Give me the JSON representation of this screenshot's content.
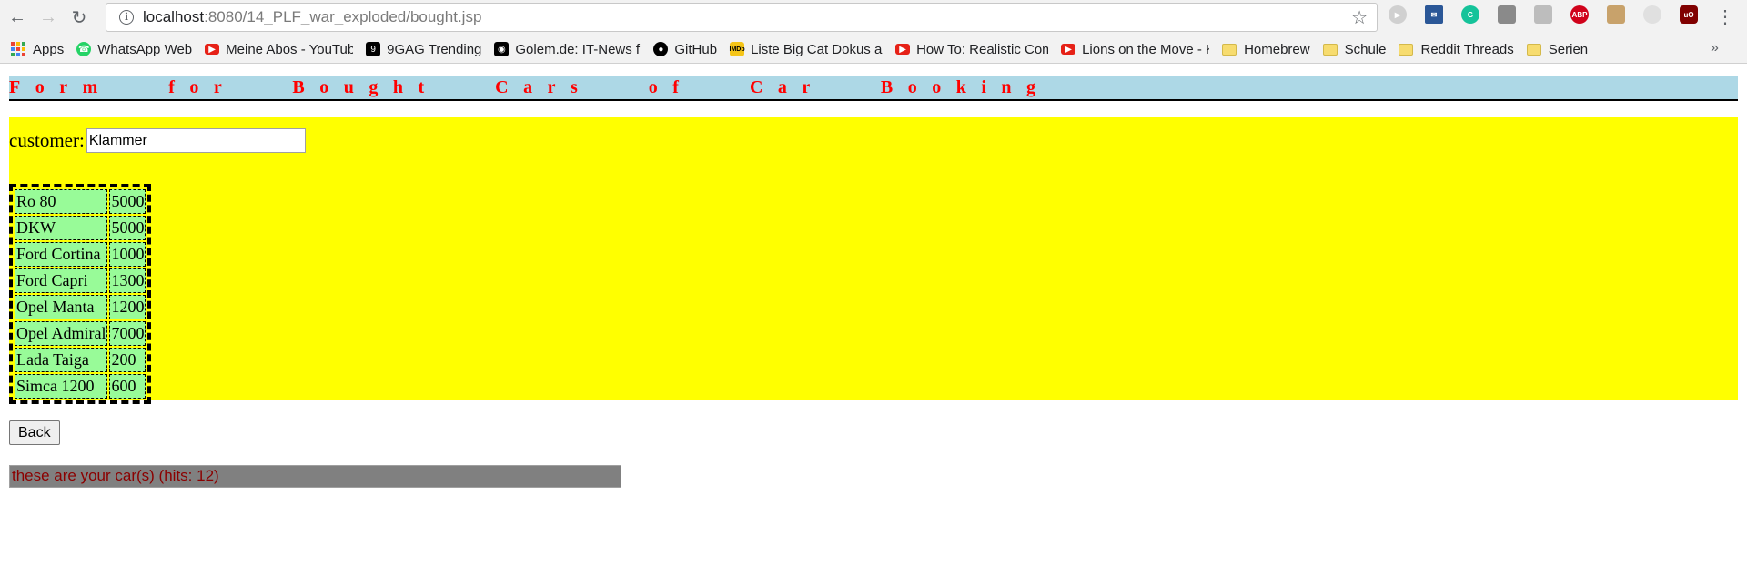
{
  "browser": {
    "url_host": "localhost",
    "url_rest": ":8080/14_PLF_war_exploded/bought.jsp",
    "bookmarks": [
      {
        "label": "Apps",
        "icon": "apps-grid-icon"
      },
      {
        "label": "WhatsApp Web",
        "icon": "whatsapp-icon",
        "color": "#25d366"
      },
      {
        "label": "Meine Abos - YouTub",
        "icon": "youtube-icon",
        "color": "#e62117"
      },
      {
        "label": "9GAG Trending",
        "icon": "9gag-icon",
        "color": "#000000"
      },
      {
        "label": "Golem.de: IT-News fü",
        "icon": "golem-icon",
        "color": "#000000"
      },
      {
        "label": "GitHub",
        "icon": "github-icon",
        "color": "#000000"
      },
      {
        "label": "Liste Big Cat Dokus ar",
        "icon": "imdb-icon",
        "color": "#f5c518"
      },
      {
        "label": "How To: Realistic Com",
        "icon": "youtube-icon",
        "color": "#e62117"
      },
      {
        "label": "Lions on the Move - K",
        "icon": "youtube-icon",
        "color": "#e62117"
      },
      {
        "label": "Homebrew",
        "icon": "folder-icon"
      },
      {
        "label": "Schule",
        "icon": "folder-icon"
      },
      {
        "label": "Reddit Threads",
        "icon": "folder-icon"
      },
      {
        "label": "Serien",
        "icon": "folder-icon"
      }
    ],
    "more_bookmarks": "»"
  },
  "page": {
    "title": "Form for Bought Cars of Car Booking",
    "customer_label": "customer:",
    "customer_value": "Klammer",
    "cars": [
      {
        "name": "Ro 80",
        "price": "5000"
      },
      {
        "name": "DKW",
        "price": "5000"
      },
      {
        "name": "Ford Cortina",
        "price": "1000"
      },
      {
        "name": "Ford Capri",
        "price": "1300"
      },
      {
        "name": "Opel Manta",
        "price": "1200"
      },
      {
        "name": "Opel Admiral",
        "price": "7000"
      },
      {
        "name": "Lada Taiga",
        "price": "200"
      },
      {
        "name": "Simca 1200",
        "price": "600"
      }
    ],
    "back_label": "Back",
    "status": "these are your car(s) (hits: 12)"
  },
  "colors": {
    "title_bg": "#add8e6",
    "title_text": "#ff0000",
    "form_bg": "#ffff00",
    "table_cell_bg": "#98fb98",
    "status_bg": "#808080",
    "status_text": "#8b0000"
  }
}
